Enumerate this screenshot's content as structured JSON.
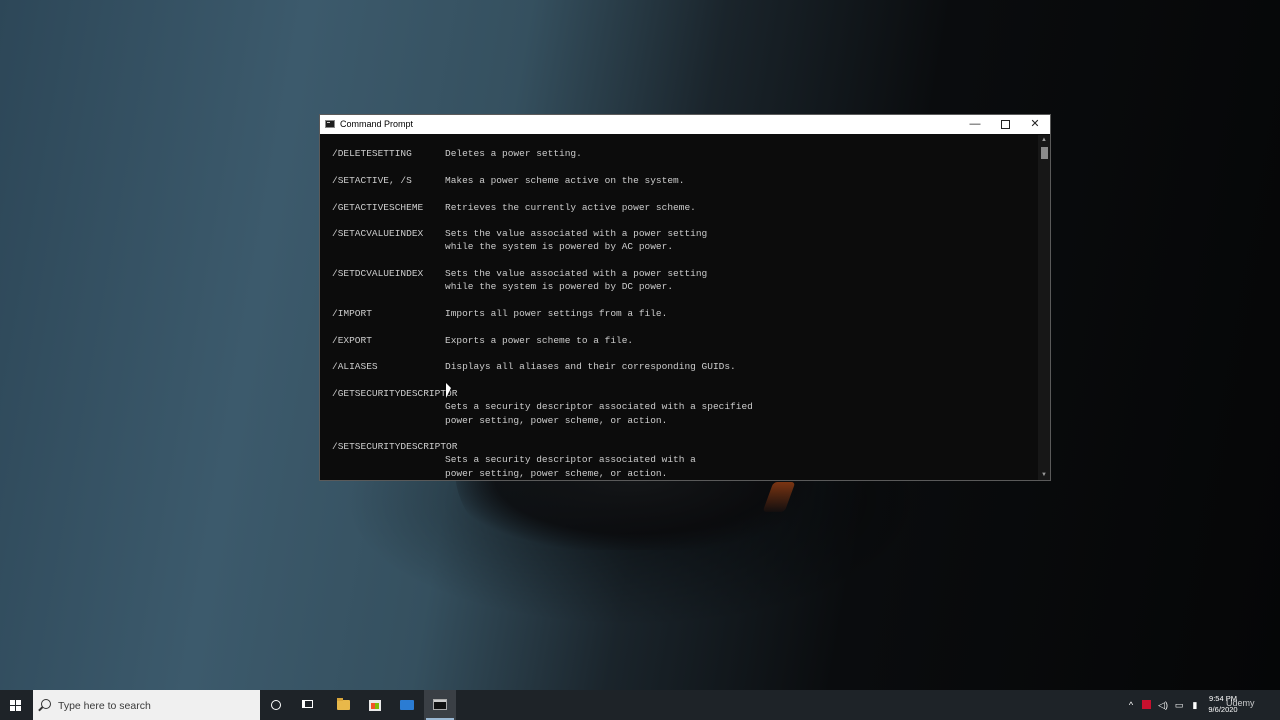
{
  "window": {
    "title": "Command Prompt",
    "minimize_label": "—",
    "close_label": "✕"
  },
  "console": {
    "entries": [
      {
        "option": "/DELETESETTING",
        "lines": [
          "Deletes a power setting."
        ]
      },
      {
        "option": "/SETACTIVE, /S",
        "lines": [
          "Makes a power scheme active on the system."
        ]
      },
      {
        "option": "/GETACTIVESCHEME",
        "lines": [
          "Retrieves the currently active power scheme."
        ]
      },
      {
        "option": "/SETACVALUEINDEX",
        "lines": [
          "Sets the value associated with a power setting",
          "while the system is powered by AC power."
        ]
      },
      {
        "option": "/SETDCVALUEINDEX",
        "lines": [
          "Sets the value associated with a power setting",
          "while the system is powered by DC power."
        ]
      },
      {
        "option": "/IMPORT",
        "lines": [
          "Imports all power settings from a file."
        ]
      },
      {
        "option": "/EXPORT",
        "lines": [
          "Exports a power scheme to a file."
        ]
      },
      {
        "option": "/ALIASES",
        "lines": [
          "Displays all aliases and their corresponding GUIDs."
        ]
      },
      {
        "option": "/GETSECURITYDESCRIPTOR",
        "lines": [
          "",
          "Gets a security descriptor associated with a specified",
          "power setting, power scheme, or action."
        ]
      },
      {
        "option": "/SETSECURITYDESCRIPTOR",
        "lines": [
          "",
          "Sets a security descriptor associated with a",
          "power setting, power scheme, or action."
        ]
      }
    ]
  },
  "taskbar": {
    "search_placeholder": "Type here to search",
    "tray_chevron": "^",
    "clock_time": "9:54 PM",
    "clock_date": "9/6/2020",
    "watermark": "Udemy"
  },
  "icons": {
    "start": "windows-start-icon",
    "search": "search-icon",
    "cortana": "cortana-icon",
    "task_view": "task-view-icon",
    "explorer": "file-explorer-icon",
    "store": "microsoft-store-icon",
    "mail": "mail-icon",
    "cmd": "command-prompt-icon"
  }
}
